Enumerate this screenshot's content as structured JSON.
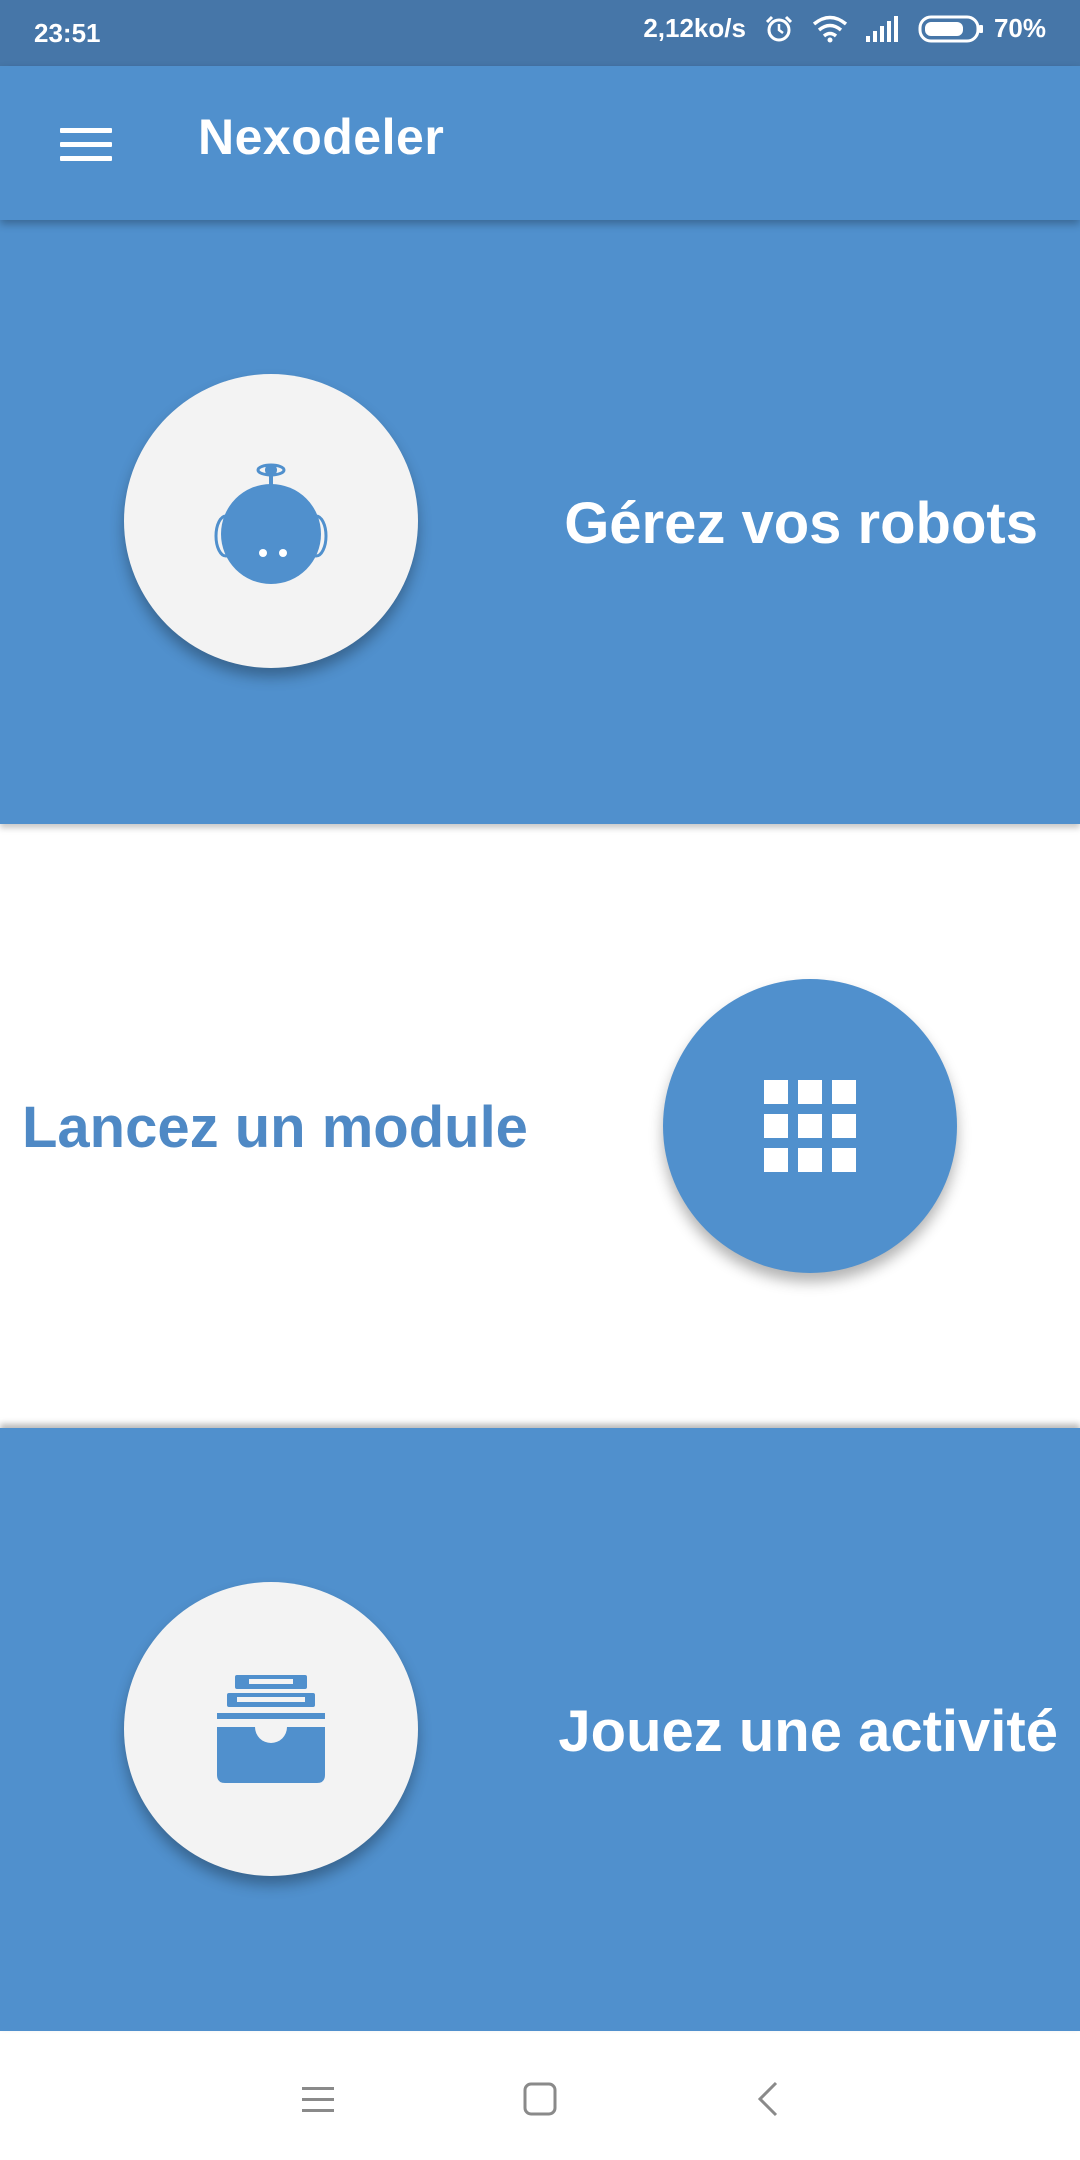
{
  "status_bar": {
    "time": "23:51",
    "speed": "2,12ko/s",
    "battery": "70%",
    "icons": [
      "alarm-icon",
      "wifi-icon",
      "signal-icon",
      "battery-icon"
    ]
  },
  "app_bar": {
    "title": "Nexodeler",
    "menu_icon": "hamburger-menu-icon"
  },
  "sections": [
    {
      "label": "Gérez vos robots",
      "icon": "robot-icon",
      "background": "#5090cd",
      "circle": "#f3f3f3"
    },
    {
      "label": "Lancez un module",
      "icon": "grid-icon",
      "background": "#ffffff",
      "circle": "#5090cd"
    },
    {
      "label": "Jouez une activité",
      "icon": "archive-box-icon",
      "background": "#5090cd",
      "circle": "#f3f3f3"
    }
  ],
  "nav_bar": {
    "buttons": [
      "recent-apps-icon",
      "home-icon",
      "back-icon"
    ]
  },
  "colors": {
    "primary": "#5090cd",
    "status_bar": "#4676a8",
    "text_on_white": "#4f89c5",
    "circle_light": "#f3f3f3"
  }
}
